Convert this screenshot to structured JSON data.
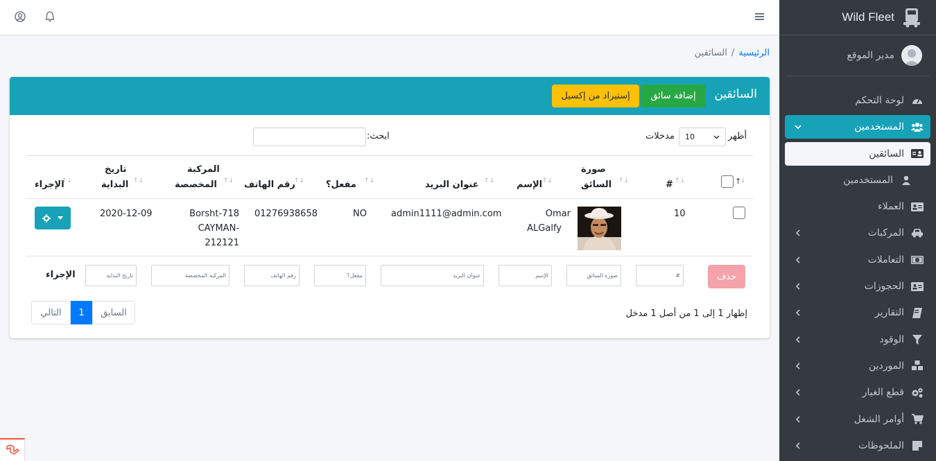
{
  "brand": {
    "name": "Wild Fleet"
  },
  "user": {
    "name": "مدير الموقع"
  },
  "sidebar": {
    "items": [
      {
        "label": "لوحة التحكم"
      },
      {
        "label": "المستخدمين"
      },
      {
        "label": "السائقين"
      },
      {
        "label": "المستخدمين"
      },
      {
        "label": "العملاء"
      },
      {
        "label": "المركبات"
      },
      {
        "label": "التعاملات"
      },
      {
        "label": "الحجوزات"
      },
      {
        "label": "التقارير"
      },
      {
        "label": "الوقود"
      },
      {
        "label": "الموردين"
      },
      {
        "label": "قطع الغيار"
      },
      {
        "label": "أوامر الشغل"
      },
      {
        "label": "الملحوظات"
      }
    ]
  },
  "breadcrumb": {
    "home": "الرئيسية",
    "separator": "/",
    "current": "السائقين"
  },
  "card": {
    "title": "السائقين",
    "add_label": "إضافة سائق",
    "import_label": "إستيراد من إكسيل"
  },
  "controls": {
    "show_label": "أظهر",
    "entries_label": "مدخلات",
    "page_length": "10",
    "search_label": "ابحث:"
  },
  "table": {
    "headers": {
      "num": "#",
      "photo_1": "صورة",
      "photo_2": "السائق",
      "name": "الإسم",
      "email": "عنوان البريد",
      "active": "مفعل؟",
      "phone": "رقم الهاتف",
      "vehicle_1": "المركبة",
      "vehicle_2": "المخصصة",
      "start_1": "تاريخ",
      "start_2": "البداية",
      "action": "الإجراء"
    },
    "row": {
      "num": "10",
      "name_1": "Omar",
      "name_2": "ALGalfy",
      "email": "admin1111@admin.com",
      "active": "NO",
      "phone": "01276938658",
      "vehicle_1": "Borsht-718",
      "vehicle_2": "CAYMAN-212121",
      "start": "2020-12-09"
    },
    "filters": {
      "num": "#",
      "photo": "صورة السائق",
      "name": "الإسم",
      "email": "عنوان البريد",
      "active": "مفعل؟",
      "phone": "رقم الهاتف",
      "vehicle": "المركبة المخصصة",
      "start": "تاريخ البداية",
      "action": "الإجراء"
    },
    "delete_label": "حذف"
  },
  "footer": {
    "info": "إظهار 1 إلى 1 من أصل 1 مدخل",
    "prev": "السابق",
    "page": "1",
    "next": "التالي"
  },
  "colors": {
    "primary": "#17a2b8",
    "success": "#28a745",
    "warning": "#ffc107",
    "sidebar": "#343a40",
    "link": "#007bff"
  }
}
